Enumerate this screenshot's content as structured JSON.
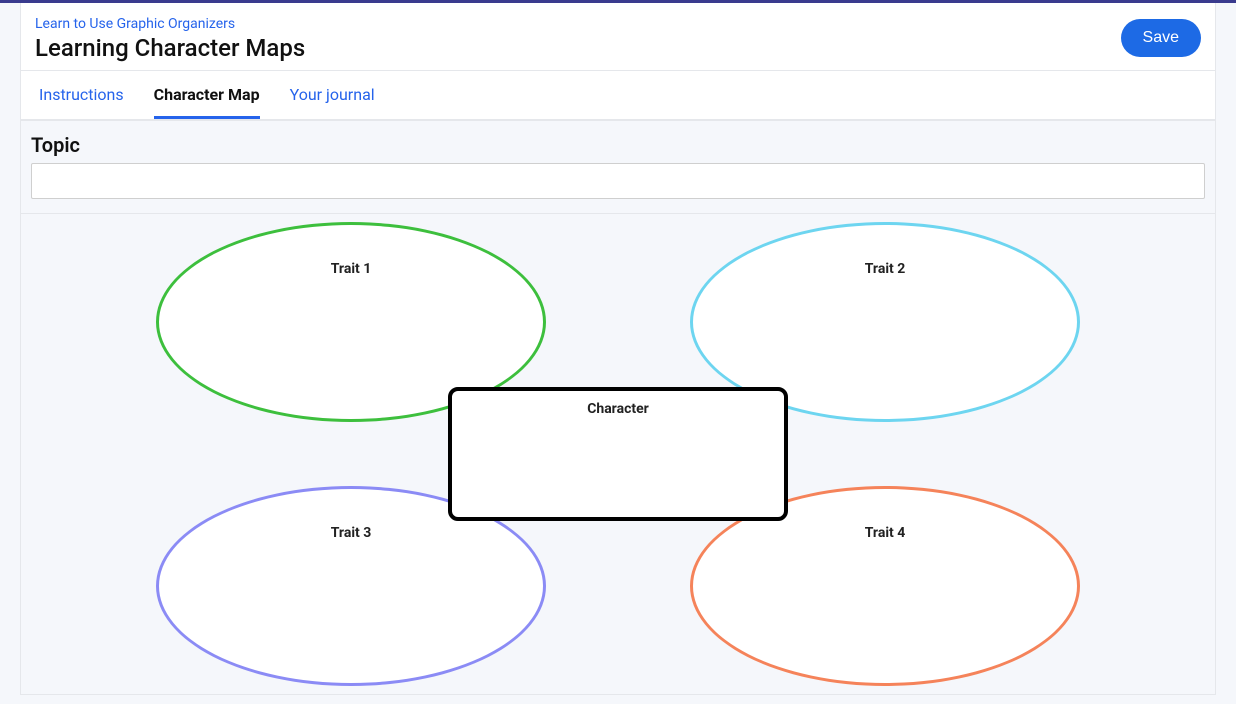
{
  "header": {
    "breadcrumb": "Learn to Use Graphic Organizers",
    "title": "Learning Character Maps",
    "save_label": "Save"
  },
  "tabs": {
    "instructions": "Instructions",
    "character_map": "Character Map",
    "journal": "Your journal"
  },
  "workspace": {
    "topic_label": "Topic",
    "topic_value": ""
  },
  "map": {
    "trait1_label": "Trait 1",
    "trait2_label": "Trait 2",
    "trait3_label": "Trait 3",
    "trait4_label": "Trait 4",
    "center_label": "Character",
    "colors": {
      "trait1": "#3dbf3d",
      "trait2": "#6dd5f0",
      "trait3": "#8b8bf5",
      "trait4": "#f5835a",
      "center": "#000000"
    }
  },
  "chart_data": {
    "type": "character-map",
    "center": {
      "label": "Character",
      "value": ""
    },
    "traits": [
      {
        "label": "Trait 1",
        "value": "",
        "color": "#3dbf3d"
      },
      {
        "label": "Trait 2",
        "value": "",
        "color": "#6dd5f0"
      },
      {
        "label": "Trait 3",
        "value": "",
        "color": "#8b8bf5"
      },
      {
        "label": "Trait 4",
        "value": "",
        "color": "#f5835a"
      }
    ]
  }
}
